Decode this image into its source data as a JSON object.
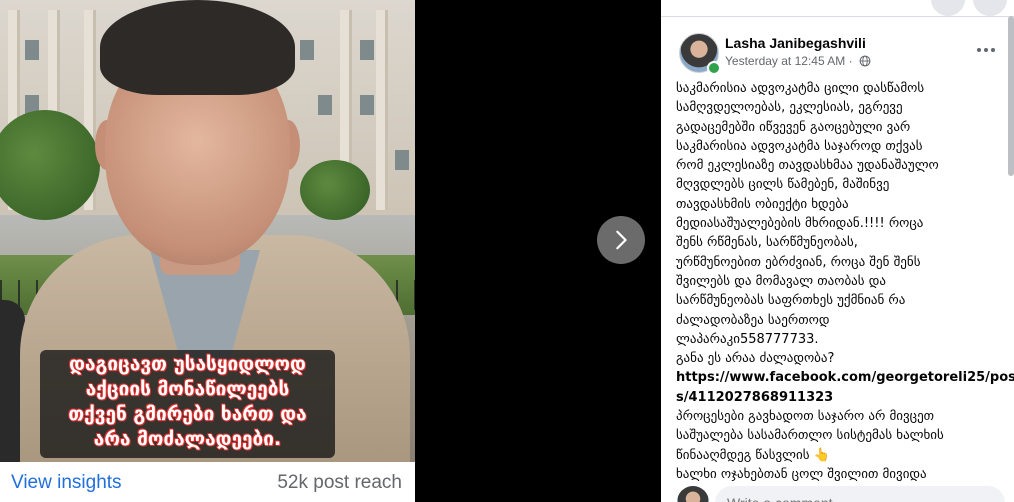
{
  "media": {
    "caption_lines": "დაგიცავთ უსასყიდლოდ\nაქციის მონაწილეებს\nთქვენ გმირები ხართ და\nარა მოძალადეები.",
    "insights_link": "View insights",
    "reach": "52k post reach"
  },
  "nav": {
    "next_icon": "chevron-right-icon"
  },
  "post": {
    "author": "Lasha Janibegashvili",
    "timestamp": "Yesterday at 12:45 AM ·",
    "privacy_icon": "globe-icon",
    "lines": [
      "საკმარისია ადვოკატმა ცილი დასწამოს",
      "სამღვდელოებას, ეკლესიას, ეგრევე",
      "გადაცემებში იწვევენ გაოცებული ვარ",
      "საკმარისია ადვოკატმა საჯაროდ თქვას",
      "რომ ეკლესიაზე თავდასხმაა უდანაშაულო",
      "მღვდლებს ცილს წამებენ, მაშინვე",
      "თავდასხმის ობიექტი ხდება",
      "მედიასაშუალებების მხრიდან.!!!! როცა",
      "შენს რწმენას, სარწმუნეობას,",
      "ურწმუნოებით ებრძვიან, როცა შენ შენს",
      "შვილებს და მომავალ თაობას და",
      "სარწმუნეობას საფრთხეს უქმნიან რა",
      "ძალადობაზეა საერთოდ",
      "ლაპარაკი558777733.",
      "განა ეს არაა ძალადობა?"
    ],
    "link_line1": "https://www.facebook.com/georgetoreli25/post",
    "link_line2": "s/4112027868911323",
    "lines_after": [
      "პროცესები გავხადოთ საჯარო არ მივცეთ",
      "საშუალება სასამართლო სისტემას ხალხის",
      "წინააღმდეგ წასვლის 👆",
      "ხალხი ოჯახებთან ცოლ შვილით მივიდა"
    ]
  },
  "comment": {
    "placeholder": "Write a comment..."
  },
  "colors": {
    "link_blue": "#216fdb",
    "online_green": "#31a24c",
    "secondary_text": "#65676b"
  }
}
